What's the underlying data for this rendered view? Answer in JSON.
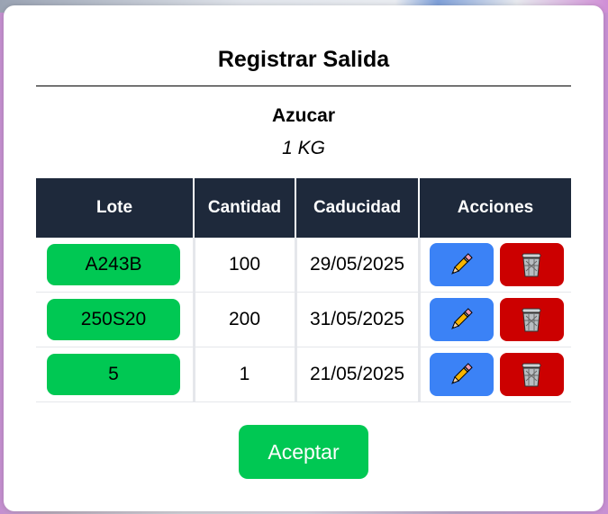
{
  "modal": {
    "title": "Registrar Salida",
    "product_name": "Azucar",
    "product_quantity": "1 KG"
  },
  "table": {
    "headers": [
      "Lote",
      "Cantidad",
      "Caducidad",
      "Acciones"
    ],
    "rows": [
      {
        "lote": "A243B",
        "cantidad": "100",
        "caducidad": "29/05/2025"
      },
      {
        "lote": "250S20",
        "cantidad": "200",
        "caducidad": "31/05/2025"
      },
      {
        "lote": "5",
        "cantidad": "1",
        "caducidad": "21/05/2025"
      }
    ],
    "edit_icon": "pencil-icon",
    "delete_icon": "trash-icon"
  },
  "footer": {
    "accept_label": "Aceptar"
  },
  "colors": {
    "header_bg": "#1e293b",
    "lote_green": "#00c853",
    "edit_blue": "#3b82f6",
    "delete_red": "#cc0000"
  }
}
